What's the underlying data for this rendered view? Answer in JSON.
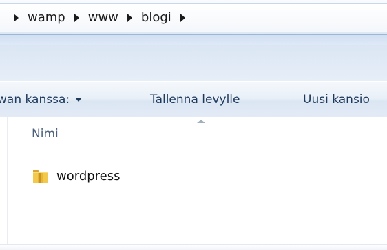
{
  "breadcrumb": {
    "items": [
      "wamp",
      "www",
      "blogi"
    ]
  },
  "toolbar": {
    "share_label": "wan kanssa:",
    "save_label": "Tallenna levylle",
    "new_folder_label": "Uusi kansio"
  },
  "file_list": {
    "column_header": "Nimi",
    "items": [
      {
        "name": "wordpress",
        "icon": "folder-icon"
      }
    ]
  },
  "colors": {
    "toolbar_text": "#1e395b",
    "folder": "#e8b83a"
  }
}
